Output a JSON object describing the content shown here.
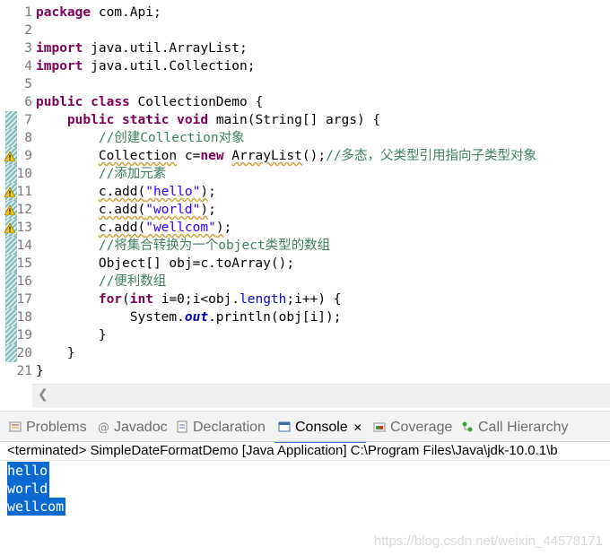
{
  "editor": {
    "lines": [
      {
        "n": "1",
        "parts": [
          {
            "c": "kw",
            "t": "package"
          },
          {
            "c": "",
            "t": " com.Api;"
          }
        ]
      },
      {
        "n": "2",
        "parts": []
      },
      {
        "n": "3",
        "parts": [
          {
            "c": "kw",
            "t": "import"
          },
          {
            "c": "",
            "t": " java.util.ArrayList;"
          }
        ]
      },
      {
        "n": "4",
        "parts": [
          {
            "c": "kw",
            "t": "import"
          },
          {
            "c": "",
            "t": " java.util.Collection;"
          }
        ]
      },
      {
        "n": "5",
        "parts": []
      },
      {
        "n": "6",
        "parts": [
          {
            "c": "kw",
            "t": "public"
          },
          {
            "c": "",
            "t": " "
          },
          {
            "c": "kw",
            "t": "class"
          },
          {
            "c": "",
            "t": " CollectionDemo {"
          }
        ]
      },
      {
        "n": "7",
        "parts": [
          {
            "c": "",
            "t": "    "
          },
          {
            "c": "kw",
            "t": "public"
          },
          {
            "c": "",
            "t": " "
          },
          {
            "c": "kw",
            "t": "static"
          },
          {
            "c": "",
            "t": " "
          },
          {
            "c": "kw",
            "t": "void"
          },
          {
            "c": "",
            "t": " main(String[] args) {"
          }
        ]
      },
      {
        "n": "8",
        "parts": [
          {
            "c": "",
            "t": "        "
          },
          {
            "c": "cm",
            "t": "//创建Collection对象"
          }
        ]
      },
      {
        "n": "9",
        "parts": [
          {
            "c": "",
            "t": "        "
          },
          {
            "c": "wv",
            "t": "Collection"
          },
          {
            "c": "",
            "t": " c="
          },
          {
            "c": "kw",
            "t": "new"
          },
          {
            "c": "",
            "t": " "
          },
          {
            "c": "wv",
            "t": "ArrayList"
          },
          {
            "c": "",
            "t": "();"
          },
          {
            "c": "cm",
            "t": "//多态，父类型引用指向子类型对象"
          }
        ]
      },
      {
        "n": "10",
        "parts": [
          {
            "c": "",
            "t": "        "
          },
          {
            "c": "cm",
            "t": "//添加元素"
          }
        ]
      },
      {
        "n": "11",
        "parts": [
          {
            "c": "",
            "t": "        "
          },
          {
            "c": "wv",
            "t": "c.add(\"hello\")"
          },
          {
            "c": "",
            "t": ";"
          }
        ],
        "str": "\"hello\""
      },
      {
        "n": "12",
        "parts": [
          {
            "c": "",
            "t": "        "
          },
          {
            "c": "wv",
            "t": "c.add(\"world\")"
          },
          {
            "c": "",
            "t": ";"
          }
        ],
        "str": "\"world\""
      },
      {
        "n": "13",
        "parts": [
          {
            "c": "",
            "t": "        "
          },
          {
            "c": "wv",
            "t": "c.add(\"wellcom\")"
          },
          {
            "c": "",
            "t": ";"
          }
        ],
        "str": "\"wellcom\""
      },
      {
        "n": "14",
        "parts": [
          {
            "c": "",
            "t": "        "
          },
          {
            "c": "cm",
            "t": "//将集合转换为一个object类型的数组"
          }
        ]
      },
      {
        "n": "15",
        "parts": [
          {
            "c": "",
            "t": "        Object[] obj=c.toArray();"
          }
        ]
      },
      {
        "n": "16",
        "parts": [
          {
            "c": "",
            "t": "        "
          },
          {
            "c": "cm",
            "t": "//便利数组"
          }
        ]
      },
      {
        "n": "17",
        "parts": [
          {
            "c": "",
            "t": "        "
          },
          {
            "c": "kw",
            "t": "for"
          },
          {
            "c": "",
            "t": "("
          },
          {
            "c": "kw",
            "t": "int"
          },
          {
            "c": "",
            "t": " i=0;i<obj."
          },
          {
            "c": "fd",
            "t": "length"
          },
          {
            "c": "",
            "t": ";i++) {"
          }
        ]
      },
      {
        "n": "18",
        "parts": [
          {
            "c": "",
            "t": "            System."
          },
          {
            "c": "sm",
            "t": "out"
          },
          {
            "c": "",
            "t": ".println(obj[i]);"
          }
        ]
      },
      {
        "n": "19",
        "parts": [
          {
            "c": "",
            "t": "        }"
          }
        ]
      },
      {
        "n": "20",
        "parts": [
          {
            "c": "",
            "t": "    }"
          }
        ]
      },
      {
        "n": "21",
        "parts": [
          {
            "c": "",
            "t": "}"
          }
        ]
      }
    ]
  },
  "tabs": [
    {
      "label": "Problems",
      "icon": "problems-icon"
    },
    {
      "label": "Javadoc",
      "icon": "javadoc-icon"
    },
    {
      "label": "Declaration",
      "icon": "declaration-icon"
    },
    {
      "label": "Console",
      "icon": "console-icon",
      "active": true,
      "close": "✕"
    },
    {
      "label": "Coverage",
      "icon": "coverage-icon"
    },
    {
      "label": "Call Hierarchy",
      "icon": "call-hierarchy-icon"
    }
  ],
  "console": {
    "status": "<terminated> SimpleDateFormatDemo [Java Application] C:\\Program Files\\Java\\jdk-10.0.1\\b",
    "output": [
      "hello",
      "world",
      "wellcom"
    ]
  },
  "watermark": "https://blog.csdn.net/weixin_44578171",
  "colors": {
    "keyword": "#7f0055",
    "comment": "#3f7f5f",
    "string": "#2a00ff",
    "selection": "#0a6ad2"
  }
}
